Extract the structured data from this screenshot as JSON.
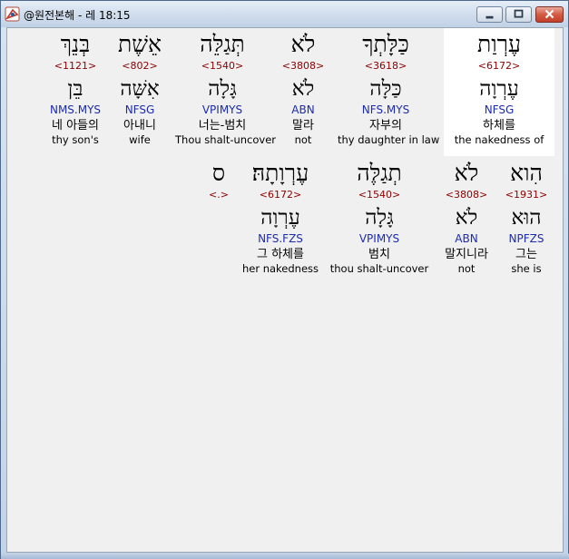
{
  "window": {
    "title": "@원전본해 - 레 18:15"
  },
  "rows": [
    [
      {
        "heb": "בְּנֵךְ",
        "strong": "<1121>",
        "lemma": "בֵּן",
        "morph": "NMS.MYS",
        "kor": "네 아들의",
        "eng": "thy son's"
      },
      {
        "heb": "אֵשֶׁת",
        "strong": "<802>",
        "lemma": "אִשָּׁה",
        "morph": "NFSG",
        "kor": "아내니",
        "eng": "wife"
      },
      {
        "heb": "תְּגַלֵּה",
        "strong": "<1540>",
        "lemma": "גָּלָה",
        "morph": "VPIMYS",
        "kor": "너는-범치",
        "eng": "Thou shalt-uncover"
      },
      {
        "heb": "לֹא",
        "strong": "<3808>",
        "lemma": "לֹא",
        "morph": "ABN",
        "kor": "말라",
        "eng": "not"
      },
      {
        "heb": "כַּלָּתְךָ",
        "strong": "<3618>",
        "lemma": "כַּלָּה",
        "morph": "NFS.MYS",
        "kor": "자부의",
        "eng": "thy daughter in law"
      },
      {
        "heb": "עֶרְוַת",
        "strong": "<6172>",
        "lemma": "עֶרְוָה",
        "morph": "NFSG",
        "kor": "하체를",
        "eng": "the nakedness of"
      }
    ],
    [
      {
        "heb": "ס",
        "strong": "<.>",
        "lemma": "",
        "morph": "",
        "kor": "",
        "eng": ""
      },
      {
        "heb": "עֶרְוָתָהּ׃",
        "strong": "<6172>",
        "lemma": "עֶרְוָה",
        "morph": "NFS.FZS",
        "kor": "그 하체를",
        "eng": "her nakedness"
      },
      {
        "heb": "תְגַלֶּה",
        "strong": "<1540>",
        "lemma": "גָּלָה",
        "morph": "VPIMYS",
        "kor": "범치",
        "eng": "thou shalt-uncover"
      },
      {
        "heb": "לֹא",
        "strong": "<3808>",
        "lemma": "לֹא",
        "morph": "ABN",
        "kor": "말지니라",
        "eng": "not"
      },
      {
        "heb": "הִוא",
        "strong": "<1931>",
        "lemma": "הוּא",
        "morph": "NPFZS",
        "kor": "그는",
        "eng": "she is"
      }
    ]
  ]
}
